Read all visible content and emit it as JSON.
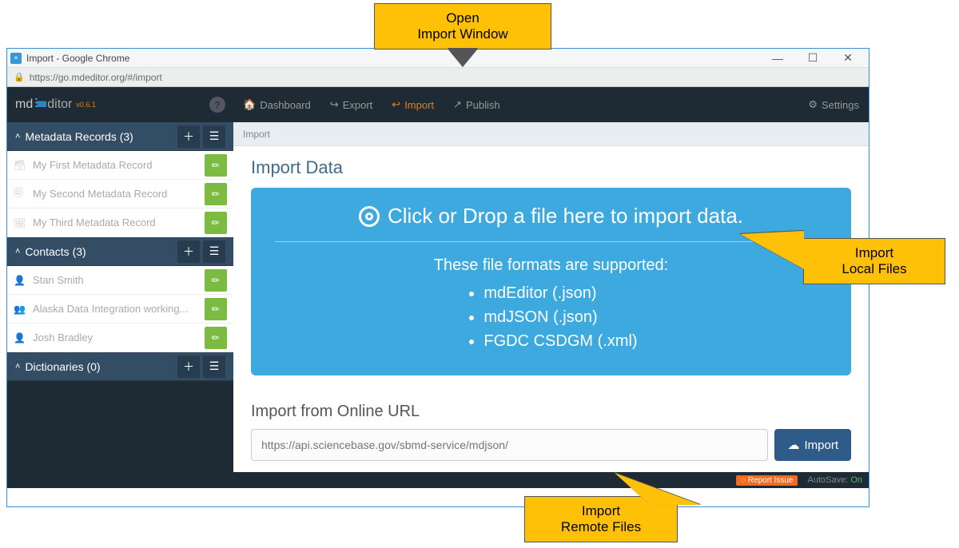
{
  "window": {
    "title": "Import - Google Chrome",
    "url": "https://go.mdeditor.org/#/import"
  },
  "brand": {
    "md": "md",
    "editor": "ditor",
    "version": "v0.6.1"
  },
  "nav": {
    "dashboard": "Dashboard",
    "export": "Export",
    "import": "Import",
    "publish": "Publish",
    "settings": "Settings"
  },
  "sidebar": {
    "sections": [
      {
        "title": "Metadata Records (3)",
        "items": [
          "My First Metadata Record",
          "My Second Metadata Record",
          "My Third Metadata Record"
        ]
      },
      {
        "title": "Contacts (3)",
        "items": [
          "Stan Smith",
          "Alaska Data Integration working...",
          "Josh Bradley"
        ]
      },
      {
        "title": "Dictionaries (0)",
        "items": []
      }
    ]
  },
  "breadcrumb": "Import",
  "page": {
    "title": "Import Data",
    "drop_headline": "Click or Drop a file here to import data.",
    "drop_sub": "These file formats are supported:",
    "formats": [
      "mdEditor (.json)",
      "mdJSON (.json)",
      "FGDC CSDGM (.xml)"
    ],
    "url_title": "Import from Online URL",
    "url_placeholder": "https://api.sciencebase.gov/sbmd-service/mdjson/",
    "import_btn": "Import"
  },
  "footer": {
    "report": "Report Issue",
    "autosave_label": "AutoSave:",
    "autosave_value": "On"
  },
  "callouts": {
    "top": "Open\nImport Window",
    "right": "Import\nLocal Files",
    "bottom": "Import\nRemote Files"
  }
}
